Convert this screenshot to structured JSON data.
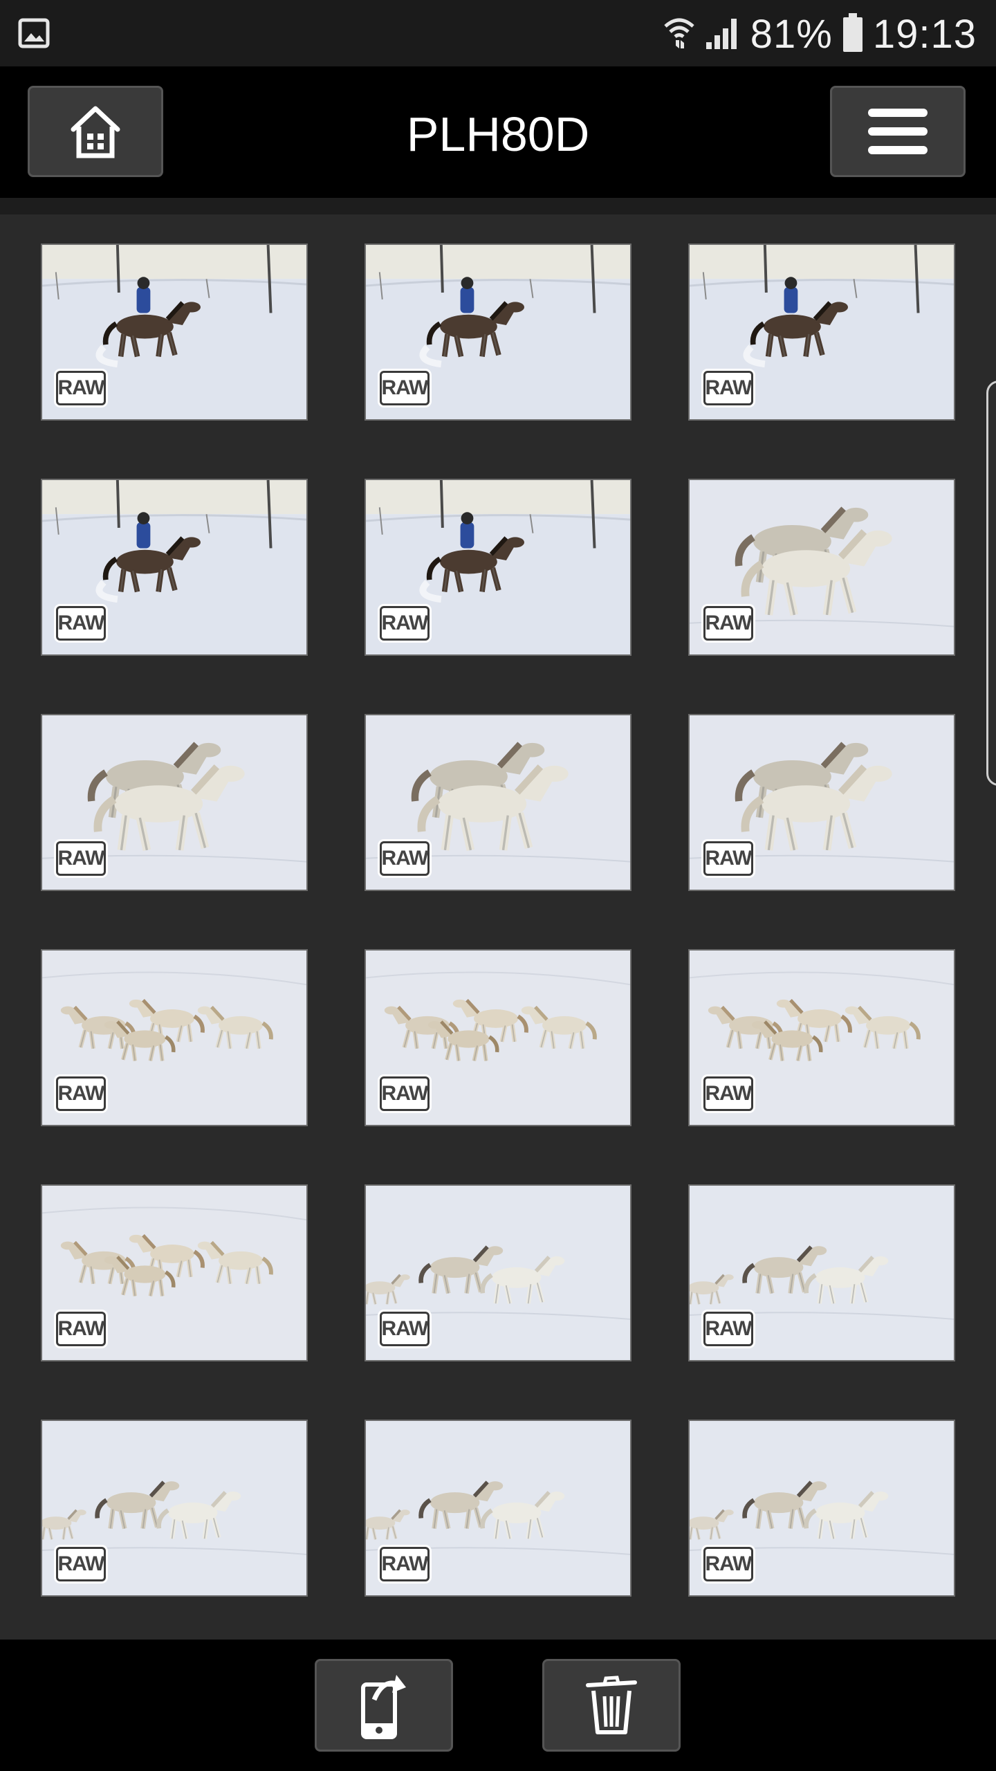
{
  "status_bar": {
    "battery_text": "81%",
    "time": "19:13",
    "icons": [
      "gallery-notification-icon",
      "wifi-icon",
      "signal-icon",
      "battery-icon"
    ]
  },
  "header": {
    "title": "PLH80D",
    "home_icon": "home-icon",
    "menu_icon": "hamburger-menu-icon"
  },
  "grid": {
    "badge": "RAW",
    "thumbnails": [
      {
        "scene": "rider"
      },
      {
        "scene": "rider"
      },
      {
        "scene": "rider"
      },
      {
        "scene": "rider"
      },
      {
        "scene": "rider"
      },
      {
        "scene": "horses-close"
      },
      {
        "scene": "horses-close"
      },
      {
        "scene": "horses-close"
      },
      {
        "scene": "horses-close"
      },
      {
        "scene": "herd"
      },
      {
        "scene": "herd"
      },
      {
        "scene": "herd"
      },
      {
        "scene": "herd"
      },
      {
        "scene": "pair"
      },
      {
        "scene": "pair"
      },
      {
        "scene": "pair"
      },
      {
        "scene": "pair"
      },
      {
        "scene": "pair"
      }
    ]
  },
  "toolbar": {
    "transfer_icon": "phone-transfer-icon",
    "delete_icon": "trash-icon"
  }
}
